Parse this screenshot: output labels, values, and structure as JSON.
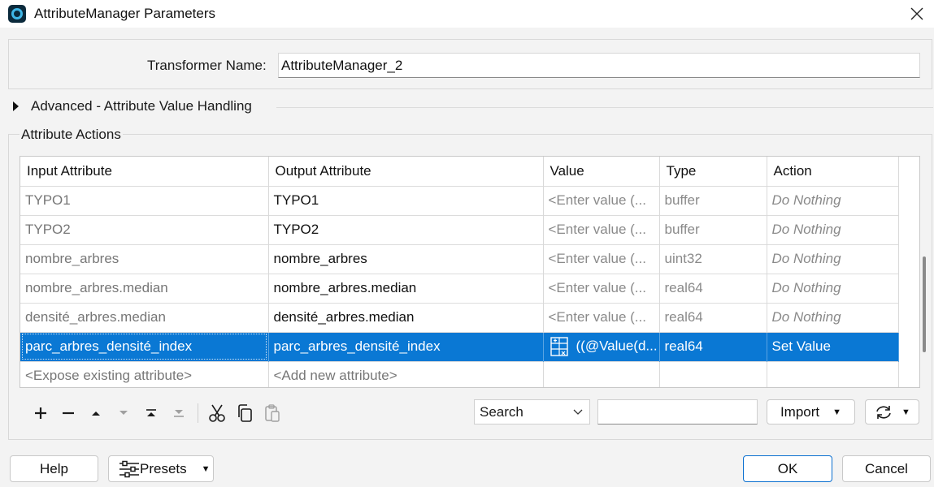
{
  "window": {
    "title": "AttributeManager Parameters",
    "close_icon": "close-icon",
    "app_icon": "fme-logo-icon"
  },
  "transformer": {
    "label": "Transformer Name:",
    "value": "AttributeManager_2"
  },
  "advanced": {
    "label": "Advanced - Attribute Value Handling",
    "expand_icon": "triangle-right-icon"
  },
  "attribute_actions": {
    "title": "Attribute Actions",
    "columns": [
      "Input Attribute",
      "Output Attribute",
      "Value",
      "Type",
      "Action"
    ],
    "rows": [
      {
        "input": "TYPO1",
        "output": "TYPO1",
        "value": "<Enter value (...",
        "type": "buffer",
        "action": "Do Nothing"
      },
      {
        "input": "TYPO2",
        "output": "TYPO2",
        "value": "<Enter value (...",
        "type": "buffer",
        "action": "Do Nothing"
      },
      {
        "input": "nombre_arbres",
        "output": "nombre_arbres",
        "value": "<Enter value (...",
        "type": "uint32",
        "action": "Do Nothing"
      },
      {
        "input": "nombre_arbres.median",
        "output": "nombre_arbres.median",
        "value": "<Enter value (...",
        "type": "real64",
        "action": "Do Nothing"
      },
      {
        "input": "densité_arbres.median",
        "output": "densité_arbres.median",
        "value": "<Enter value (...",
        "type": "real64",
        "action": "Do Nothing"
      },
      {
        "input": "parc_arbres_densité_index",
        "output": "parc_arbres_densité_index",
        "value": "((@Value(d...",
        "type": "real64",
        "action": "Set Value",
        "selected": true
      }
    ],
    "add_row": {
      "input": "<Expose existing attribute>",
      "output": "<Add new attribute>"
    }
  },
  "toolbar": {
    "icons": [
      "plus-icon",
      "minus-icon",
      "move-up-icon",
      "move-down-icon",
      "move-top-icon",
      "move-bottom-icon",
      "cut-icon",
      "copy-icon",
      "paste-icon"
    ],
    "search_select": "Search",
    "import_label": "Import",
    "sync_icon": "refresh-icon"
  },
  "footer": {
    "help": "Help",
    "presets": "Presets",
    "ok": "OK",
    "cancel": "Cancel"
  },
  "colors": {
    "selection": "#0a78d4",
    "accent_border": "#0a6fd0",
    "background": "#f3f3f3"
  }
}
